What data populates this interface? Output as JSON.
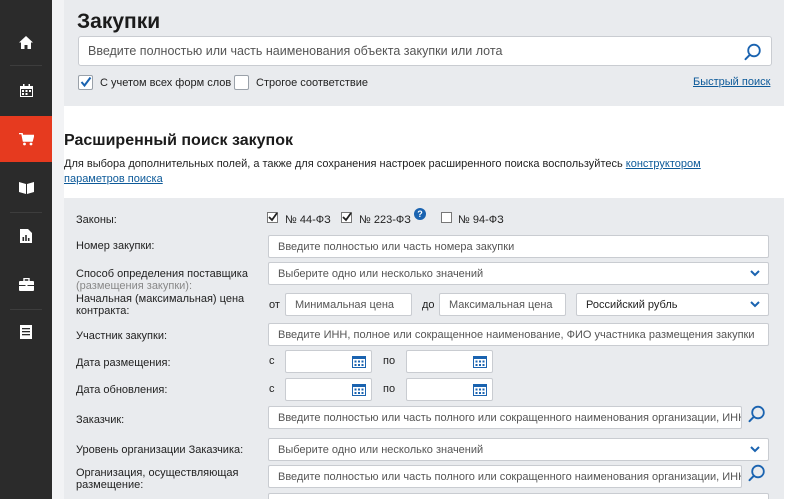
{
  "sidebar": {
    "items": [
      {
        "icon": "home-icon"
      },
      {
        "icon": "calendar-icon"
      },
      {
        "icon": "cart-icon",
        "active": true
      },
      {
        "icon": "book-icon"
      },
      {
        "icon": "report-icon"
      },
      {
        "icon": "briefcase-icon"
      },
      {
        "icon": "document-icon"
      }
    ],
    "active_color": "#e63a1f"
  },
  "search": {
    "title": "Закупки",
    "placeholder": "Введите полностью или часть наименования объекта закупки или лота",
    "opt_word_forms": "С учетом всех форм слов",
    "opt_word_forms_checked": true,
    "opt_strict": "Строгое соответствие",
    "opt_strict_checked": false,
    "quick_link": "Быстрый поиск"
  },
  "advanced": {
    "title": "Расширенный поиск закупок",
    "desc_text": "Для выбора дополнительных полей, а также для сохранения настроек расширенного поиска воспользуйтесь ",
    "desc_link": "конструктором параметров поиска"
  },
  "form": {
    "laws": {
      "label": "Законы:",
      "options": [
        {
          "label": "№ 44-ФЗ",
          "checked": true
        },
        {
          "label": "№ 223-ФЗ",
          "checked": true
        },
        {
          "label": "№ 94-ФЗ",
          "checked": false
        }
      ],
      "help": "?"
    },
    "number": {
      "label": "Номер закупки:",
      "placeholder": "Введите полностью или часть номера закупки"
    },
    "supplier_method": {
      "label": "Способ определения поставщика",
      "sublabel": "(размещения закупки):",
      "value": "Выберите одно или несколько значений"
    },
    "price": {
      "label": "Начальная (максимальная) цена контракта:",
      "from_label": "от",
      "from_placeholder": "Минимальная цена",
      "to_label": "до",
      "to_placeholder": "Максимальная цена",
      "currency": "Российский рубль"
    },
    "participant": {
      "label": "Участник закупки:",
      "placeholder": "Введите ИНН, полное или сокращенное наименование, ФИО участника размещения закупки"
    },
    "date_placed": {
      "label": "Дата размещения:",
      "from_label": "с",
      "to_label": "по"
    },
    "date_updated": {
      "label": "Дата обновления:",
      "from_label": "с",
      "to_label": "по"
    },
    "customer": {
      "label": "Заказчик:",
      "placeholder": "Введите полностью или часть полного или сокращенного наименования организации, ИНН"
    },
    "customer_level": {
      "label": "Уровень организации Заказчика:",
      "value": "Выберите одно или несколько значений"
    },
    "organizer": {
      "label": "Организация, осуществляющая размещение:",
      "placeholder": "Введите полностью или часть полного или сокращенного наименования организации, ИНН"
    }
  },
  "colors": {
    "accent_link": "#0d5a99",
    "panel_bg": "#e9ebee",
    "sidebar_bg": "#2b2b2b",
    "icon_blue": "#1a63b0"
  }
}
